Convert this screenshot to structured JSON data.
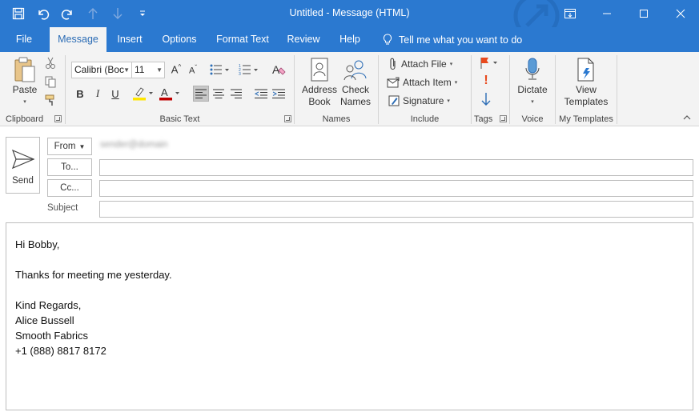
{
  "window": {
    "title": "Untitled  -  Message (HTML)"
  },
  "tabs": [
    {
      "label": "File"
    },
    {
      "label": "Message"
    },
    {
      "label": "Insert"
    },
    {
      "label": "Options"
    },
    {
      "label": "Format Text"
    },
    {
      "label": "Review"
    },
    {
      "label": "Help"
    }
  ],
  "tellme": {
    "label": "Tell me what you want to do"
  },
  "ribbon": {
    "clipboard": {
      "paste": "Paste",
      "label": "Clipboard"
    },
    "basic_text": {
      "font": "Calibri (Boc",
      "size": "11",
      "label": "Basic Text"
    },
    "names": {
      "address_book_1": "Address",
      "address_book_2": "Book",
      "check_names_1": "Check",
      "check_names_2": "Names",
      "label": "Names"
    },
    "include": {
      "attach_file": "Attach File",
      "attach_item": "Attach Item",
      "signature": "Signature",
      "label": "Include"
    },
    "tags": {
      "label": "Tags"
    },
    "voice": {
      "dictate": "Dictate",
      "label": "Voice"
    },
    "templates": {
      "view_1": "View",
      "view_2": "Templates",
      "label": "My Templates"
    }
  },
  "compose": {
    "send": "Send",
    "from": "From",
    "from_address": "sender@domain",
    "to": "To...",
    "cc": "Cc...",
    "subject": "Subject",
    "to_value": "",
    "cc_value": "",
    "subject_value": ""
  },
  "body": {
    "lines": [
      "Hi Bobby,",
      "",
      "Thanks for meeting me yesterday.",
      "",
      "Kind Regards,",
      "Alice Bussell",
      "Smooth Fabrics",
      "+1 (888) 8817 8172"
    ]
  },
  "colors": {
    "accent": "#2b79d0",
    "ribbon_bg": "#f3f3f3",
    "active_tab_text": "#2b6cb5",
    "highlight": "#ffe600",
    "font_color": "#c00000"
  }
}
